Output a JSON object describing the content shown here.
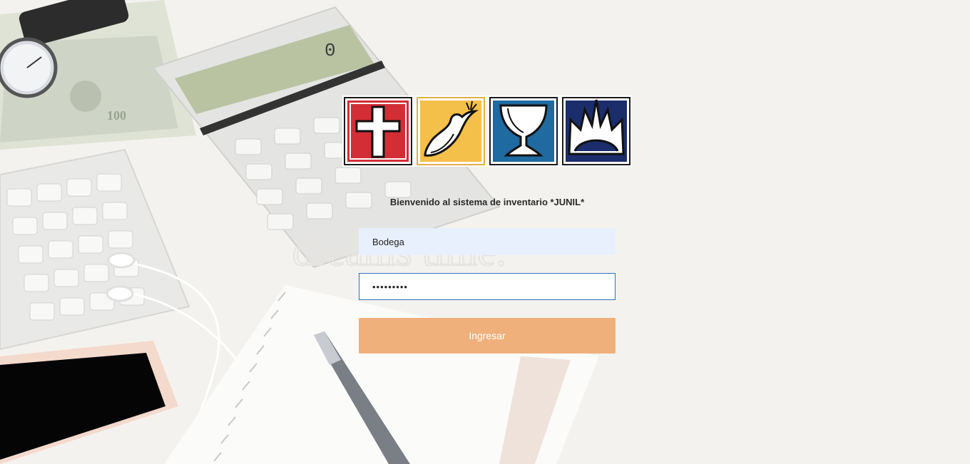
{
  "login": {
    "welcome_text": "Bienvenido al sistema de inventario *JUNIL*",
    "username_value": "Bodega",
    "password_value": "•••••••••",
    "submit_label": "Ingresar"
  },
  "logo": {
    "tiles": [
      {
        "icon": "cross-icon",
        "color": "#d32d35"
      },
      {
        "icon": "dove-icon",
        "color": "#f5c04a"
      },
      {
        "icon": "chalice-icon",
        "color": "#1f6aa0"
      },
      {
        "icon": "crown-icon",
        "color": "#1c2d6b"
      }
    ]
  },
  "background": {
    "calculator_display": "0"
  },
  "colors": {
    "button": "#f0b07b",
    "input_autofill": "#e8f0fe",
    "input_focus_border": "#2f6fb1"
  }
}
